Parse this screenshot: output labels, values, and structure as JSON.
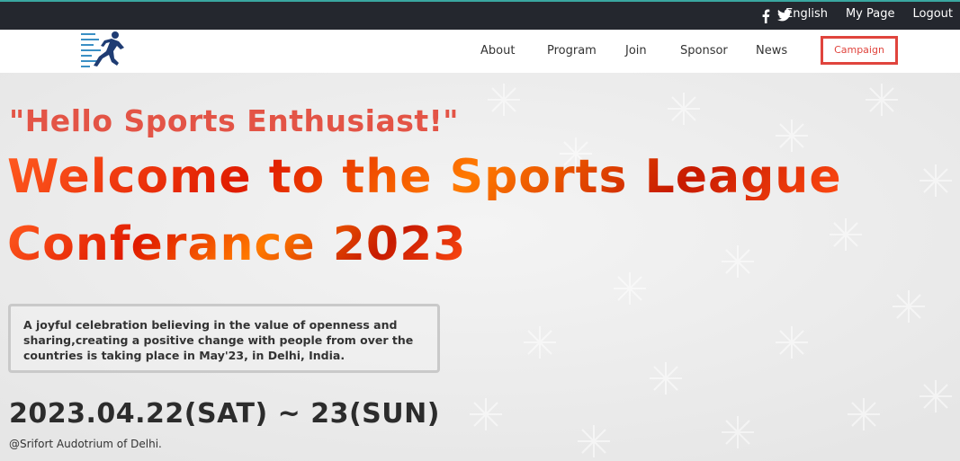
{
  "topbar": {
    "icons": [
      "facebook-icon",
      "twitter-icon"
    ],
    "links": [
      "English",
      "My Page",
      "Logout"
    ]
  },
  "nav": {
    "items": [
      "About",
      "Program",
      "Join",
      "Sponsor",
      "News"
    ],
    "campaign": "Campaign"
  },
  "hero": {
    "greeting": "\"Hello Sports Enthusiast!\"",
    "title_line1": "Welcome to the Sports League",
    "title_line2": "Conferance 2023",
    "description": "A joyful celebration believing in the value of openness and sharing,creating a positive change with people from over the countries is taking place in May'23, in Delhi, India.",
    "date": "2023.04.22(SAT) ~ 23(SUN)",
    "venue": "@Srifort Audotrium of Delhi."
  },
  "colors": {
    "topbar_bg": "#24272e",
    "accent_red": "#e0443d",
    "greeting": "#e35446",
    "title_fire": "#ff5a1f"
  }
}
